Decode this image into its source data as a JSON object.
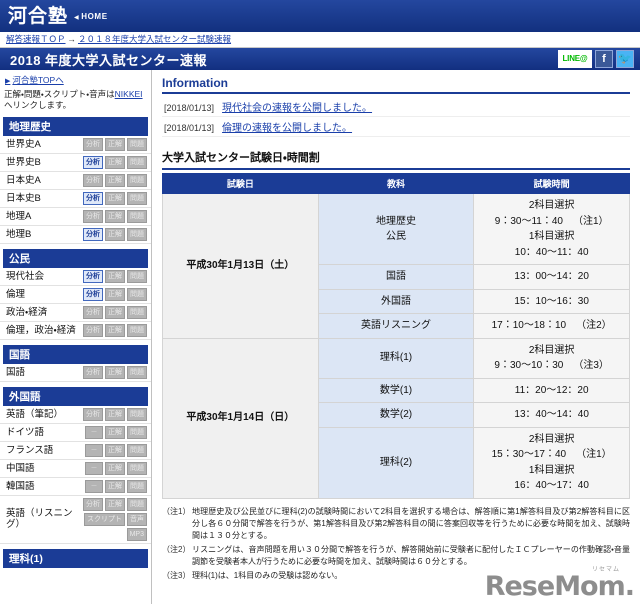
{
  "brand": {
    "logo": "河合塾",
    "home_label": "HOME",
    "home_arrow": "◀"
  },
  "breadcrumb": {
    "items": [
      "解答速報ＴＯＰ",
      "２０１８年度大学入試センター試験速報"
    ],
    "separator": "→"
  },
  "header": {
    "title": "2018 年度大学入試センター速報",
    "social": [
      {
        "name": "LINE@",
        "label": "LINE@"
      },
      {
        "name": "facebook",
        "label": "f"
      },
      {
        "name": "twitter",
        "label": "🐦"
      }
    ]
  },
  "sidebar": {
    "top_link": "河合塾TOPへ",
    "top_arrow": "▶",
    "note_before": "正解・問題・スクリプト・音声は",
    "note_link": "NIKKEI",
    "note_after": "へリンクします。",
    "groups": [
      {
        "heading": "地理歴史",
        "rows": [
          {
            "label": "世界史A",
            "buttons": [
              {
                "text": "分析",
                "state": "off"
              },
              {
                "text": "正解",
                "state": "off"
              },
              {
                "text": "問題",
                "state": "off"
              }
            ]
          },
          {
            "label": "世界史B",
            "buttons": [
              {
                "text": "分析",
                "state": "on"
              },
              {
                "text": "正解",
                "state": "off"
              },
              {
                "text": "問題",
                "state": "off"
              }
            ]
          },
          {
            "label": "日本史A",
            "buttons": [
              {
                "text": "分析",
                "state": "off"
              },
              {
                "text": "正解",
                "state": "off"
              },
              {
                "text": "問題",
                "state": "off"
              }
            ]
          },
          {
            "label": "日本史B",
            "buttons": [
              {
                "text": "分析",
                "state": "on"
              },
              {
                "text": "正解",
                "state": "off"
              },
              {
                "text": "問題",
                "state": "off"
              }
            ]
          },
          {
            "label": "地理A",
            "buttons": [
              {
                "text": "分析",
                "state": "off"
              },
              {
                "text": "正解",
                "state": "off"
              },
              {
                "text": "問題",
                "state": "off"
              }
            ]
          },
          {
            "label": "地理B",
            "buttons": [
              {
                "text": "分析",
                "state": "on"
              },
              {
                "text": "正解",
                "state": "off"
              },
              {
                "text": "問題",
                "state": "off"
              }
            ]
          }
        ]
      },
      {
        "heading": "公民",
        "rows": [
          {
            "label": "現代社会",
            "buttons": [
              {
                "text": "分析",
                "state": "on"
              },
              {
                "text": "正解",
                "state": "off"
              },
              {
                "text": "問題",
                "state": "off"
              }
            ]
          },
          {
            "label": "倫理",
            "buttons": [
              {
                "text": "分析",
                "state": "on"
              },
              {
                "text": "正解",
                "state": "off"
              },
              {
                "text": "問題",
                "state": "off"
              }
            ]
          },
          {
            "label": "政治・経済",
            "buttons": [
              {
                "text": "分析",
                "state": "off"
              },
              {
                "text": "正解",
                "state": "off"
              },
              {
                "text": "問題",
                "state": "off"
              }
            ]
          },
          {
            "label": "倫理，政治・経済",
            "buttons": [
              {
                "text": "分析",
                "state": "off"
              },
              {
                "text": "正解",
                "state": "off"
              },
              {
                "text": "問題",
                "state": "off"
              }
            ]
          }
        ]
      },
      {
        "heading": "国語",
        "rows": [
          {
            "label": "国語",
            "buttons": [
              {
                "text": "分析",
                "state": "off"
              },
              {
                "text": "正解",
                "state": "off"
              },
              {
                "text": "問題",
                "state": "off"
              }
            ]
          }
        ]
      },
      {
        "heading": "外国語",
        "rows": [
          {
            "label": "英語（筆記）",
            "buttons": [
              {
                "text": "分析",
                "state": "off"
              },
              {
                "text": "正解",
                "state": "off"
              },
              {
                "text": "問題",
                "state": "off"
              }
            ]
          },
          {
            "label": "ドイツ語",
            "buttons": [
              {
                "text": "－",
                "state": "dash"
              },
              {
                "text": "正解",
                "state": "off"
              },
              {
                "text": "問題",
                "state": "off"
              }
            ]
          },
          {
            "label": "フランス語",
            "buttons": [
              {
                "text": "－",
                "state": "dash"
              },
              {
                "text": "正解",
                "state": "off"
              },
              {
                "text": "問題",
                "state": "off"
              }
            ]
          },
          {
            "label": "中国語",
            "buttons": [
              {
                "text": "－",
                "state": "dash"
              },
              {
                "text": "正解",
                "state": "off"
              },
              {
                "text": "問題",
                "state": "off"
              }
            ]
          },
          {
            "label": "韓国語",
            "buttons": [
              {
                "text": "－",
                "state": "dash"
              },
              {
                "text": "正解",
                "state": "off"
              },
              {
                "text": "問題",
                "state": "off"
              }
            ]
          },
          {
            "label": "英語（リスニング）",
            "buttons": [
              {
                "text": "分析",
                "state": "off"
              },
              {
                "text": "正解",
                "state": "off"
              },
              {
                "text": "問題",
                "state": "off"
              },
              {
                "text": "スクリプト",
                "state": "off"
              },
              {
                "text": "音声",
                "state": "off"
              },
              {
                "text": "MP3",
                "state": "off"
              }
            ]
          }
        ]
      },
      {
        "heading": "理科(1)",
        "rows": []
      }
    ]
  },
  "main": {
    "information": {
      "title": "Information",
      "items": [
        {
          "date": "[2018/01/13]",
          "text": "現代社会の速報を公開しました。"
        },
        {
          "date": "[2018/01/13]",
          "text": "倫理の速報を公開しました。"
        }
      ]
    },
    "schedule": {
      "title": "大学入試センター試験日・時間割",
      "columns": [
        "試験日",
        "教科",
        "試験時間"
      ],
      "days": [
        {
          "date": "平成30年1月13日（土）",
          "rows": [
            {
              "subject": "地理歴史\n公民",
              "time": "2科目選択\n9：30〜11：40\n1科目選択\n10：40〜11：40",
              "note": "（注1）"
            },
            {
              "subject": "国語",
              "time": "13：00〜14：20",
              "note": ""
            },
            {
              "subject": "外国語",
              "time": "15：10〜16：30",
              "note": ""
            },
            {
              "subject": "英語リスニング",
              "time": "17：10〜18：10",
              "note": "（注2）"
            }
          ]
        },
        {
          "date": "平成30年1月14日（日）",
          "rows": [
            {
              "subject": "理科(1)",
              "time": "2科目選択\n9：30〜10：30",
              "note": "（注3）"
            },
            {
              "subject": "数学(1)",
              "time": "11：20〜12：20",
              "note": ""
            },
            {
              "subject": "数学(2)",
              "time": "13：40〜14：40",
              "note": ""
            },
            {
              "subject": "理科(2)",
              "time": "2科目選択\n15：30〜17：40\n1科目選択\n16：40〜17：40",
              "note": "（注1）"
            }
          ]
        }
      ],
      "notes": [
        {
          "label": "（注1）",
          "text": "地理歴史及び公民並びに理科(2)の試験時間において2科目を選択する場合は、解答順に第1解答科目及び第2解答科目に区分し各６０分間で解答を行うが、第1解答科目及び第2解答科目の間に答案回収等を行うために必要な時間を加え、試験時間は１３０分とする。"
        },
        {
          "label": "（注2）",
          "text": "リスニングは、音声問題を用い３０分間で解答を行うが、解答開始前に受験者に配付したＩＣプレーヤーの作動確認・音量調節を受験者本人が行うために必要な時間を加え、試験時間は６０分とする。"
        },
        {
          "label": "（注3）",
          "text": "理科(1)は、1科目のみの受験は認めない。"
        }
      ]
    }
  },
  "watermark": {
    "main": "ReseMom.",
    "sub": "リセマム"
  }
}
